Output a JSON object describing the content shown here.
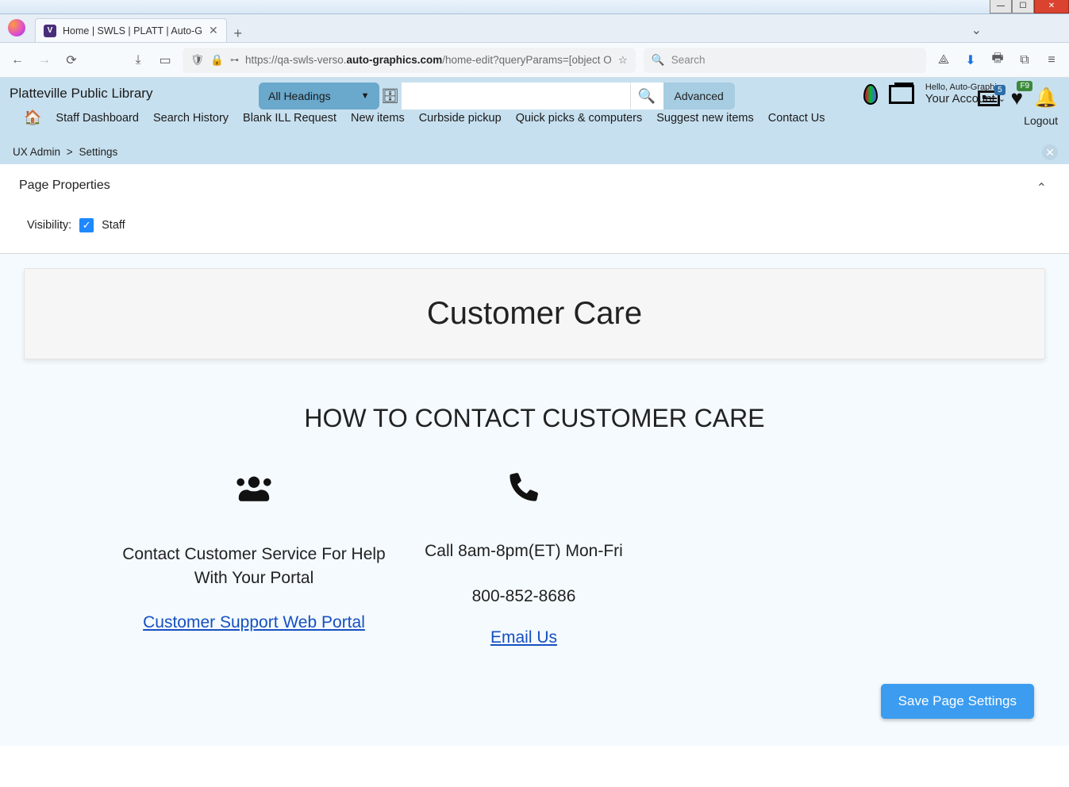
{
  "browser": {
    "tab_title": "Home | SWLS | PLATT | Auto-G",
    "url_prefix": "https://qa-swls-verso.",
    "url_domain": "auto-graphics.com",
    "url_path": "/home-edit?queryParams=[object O",
    "search_placeholder": "Search"
  },
  "header": {
    "library_name": "Platteville Public Library",
    "dropdown_label": "All Headings",
    "advanced": "Advanced",
    "hello": "Hello, Auto-Graphics",
    "account": "Your Account",
    "logout": "Logout",
    "card_badge": "5",
    "heart_badge": "F9"
  },
  "nav": {
    "items": [
      "Staff Dashboard",
      "Search History",
      "Blank ILL Request",
      "New items",
      "Curbside pickup",
      "Quick picks & computers",
      "Suggest new items",
      "Contact Us"
    ]
  },
  "crumb": {
    "a": "UX Admin",
    "sep": ">",
    "b": "Settings"
  },
  "props": {
    "title": "Page Properties",
    "visibility_label": "Visibility:",
    "staff_label": "Staff"
  },
  "content": {
    "hero": "Customer Care",
    "how": "HOW TO CONTACT CUSTOMER CARE",
    "col1_text": "Contact Customer Service For Help With Your Portal",
    "col1_link": "Customer Support Web Portal",
    "col2_text": "Call 8am-8pm(ET) Mon-Fri",
    "col2_phone": "800-852-8686",
    "col2_link": "Email Us",
    "save": "Save Page Settings"
  }
}
